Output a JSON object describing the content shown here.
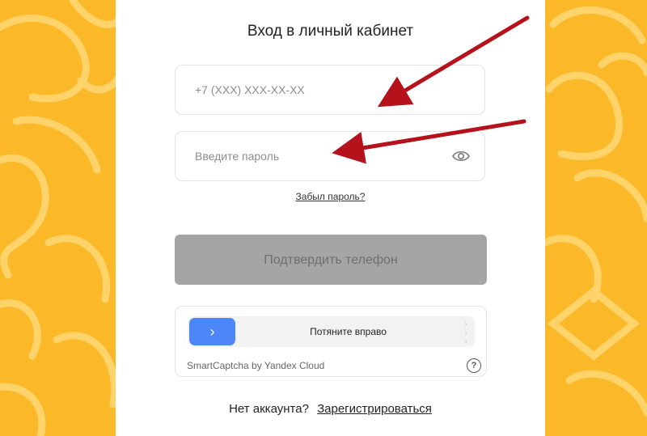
{
  "login": {
    "title": "Вход в личный кабинет",
    "phone_placeholder": "+7 (XXX) XXX-XX-XX",
    "password_placeholder": "Введите пароль",
    "forgot_password": "Забыл пароль?",
    "confirm_button": "Подтвердить телефон"
  },
  "captcha": {
    "slider_label": "Потяните вправо",
    "brand": "SmartCaptcha by Yandex Cloud"
  },
  "footer": {
    "no_account": "Нет аккаунта?",
    "register_link": "Зарегистрироваться"
  },
  "colors": {
    "background": "#fbb829",
    "slider_handle": "#4d86f7",
    "button_disabled": "#a5a5a5",
    "arrow": "#b5121b"
  }
}
